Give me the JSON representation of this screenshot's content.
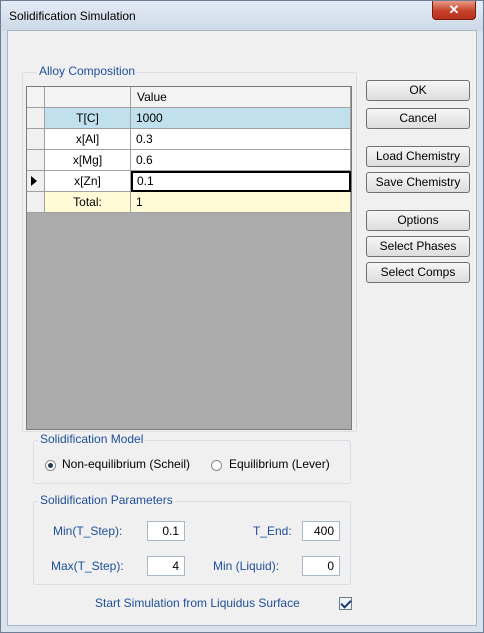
{
  "window": {
    "title": "Solidification Simulation",
    "close_label": "✕"
  },
  "composition": {
    "group_label": "Alloy Composition",
    "header": {
      "name": "",
      "value": "Value"
    },
    "rows": [
      {
        "name": "T[C]",
        "value": "1000"
      },
      {
        "name": "x[Al]",
        "value": "0.3"
      },
      {
        "name": "x[Mg]",
        "value": "0.6"
      },
      {
        "name": "x[Zn]",
        "value": "0.1"
      },
      {
        "name": "Total:",
        "value": "1"
      }
    ]
  },
  "buttons": {
    "ok": "OK",
    "cancel": "Cancel",
    "load_chemistry": "Load Chemistry",
    "save_chemistry": "Save Chemistry",
    "options": "Options",
    "select_phases": "Select Phases",
    "select_comps": "Select Comps"
  },
  "model": {
    "group_label": "Solidification Model",
    "options": [
      "Non-equilibrium (Scheil)",
      "Equilibrium (Lever)"
    ],
    "selected": "Non-equilibrium (Scheil)"
  },
  "parameters": {
    "group_label": "Solidification Parameters",
    "min_t_step": {
      "label": "Min(T_Step):",
      "value": "0.1"
    },
    "max_t_step": {
      "label": "Max(T_Step):",
      "value": "4"
    },
    "t_end": {
      "label": "T_End:",
      "value": "400"
    },
    "min_liquid": {
      "label": "Min (Liquid):",
      "value": "0"
    }
  },
  "liquidus": {
    "label": "Start Simulation from Liquidus Surface",
    "checked": true
  }
}
